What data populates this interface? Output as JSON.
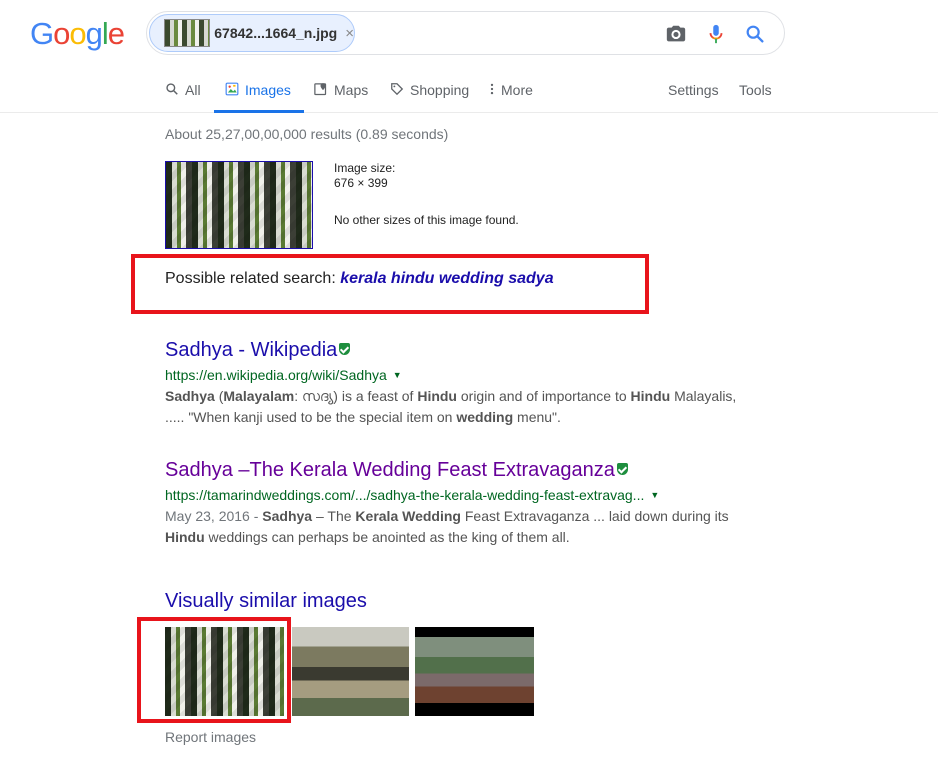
{
  "logo": {
    "text": "Google"
  },
  "search": {
    "chip_filename": "67842...1664_n.jpg",
    "chip_close": "×"
  },
  "tabs": [
    {
      "label": "All",
      "icon": "search-icon"
    },
    {
      "label": "Images",
      "icon": "image-icon",
      "active": true
    },
    {
      "label": "Maps",
      "icon": "map-icon"
    },
    {
      "label": "Shopping",
      "icon": "tag-icon"
    },
    {
      "label": "More",
      "icon": "more-vert-icon"
    }
  ],
  "tools": {
    "settings": "Settings",
    "tools": "Tools"
  },
  "results_count": "About 25,27,00,00,000 results (0.89 seconds)",
  "image_info": {
    "size_label": "Image size:",
    "size_value": "676 × 399",
    "other_sizes": "No other sizes of this image found."
  },
  "related": {
    "prefix": "Possible related search: ",
    "query": "kerala hindu wedding sadya"
  },
  "results": [
    {
      "title": "Sadhya - Wikipedia",
      "url": "https://en.wikipedia.org/wiki/Sadhya"
    },
    {
      "title": "Sadhya –The Kerala Wedding Feast Extravaganza",
      "url": "https://tamarindweddings.com/.../sadhya-the-kerala-wedding-feast-extravag...",
      "date": "May 23, 2016 - "
    }
  ],
  "visually_similar": {
    "title": "Visually similar images"
  },
  "report": "Report images",
  "colors": {
    "link": "#1a0dab",
    "visited": "#660099",
    "url_green": "#006621",
    "highlight_red": "#e8141b",
    "accent_blue": "#1a73e8"
  }
}
